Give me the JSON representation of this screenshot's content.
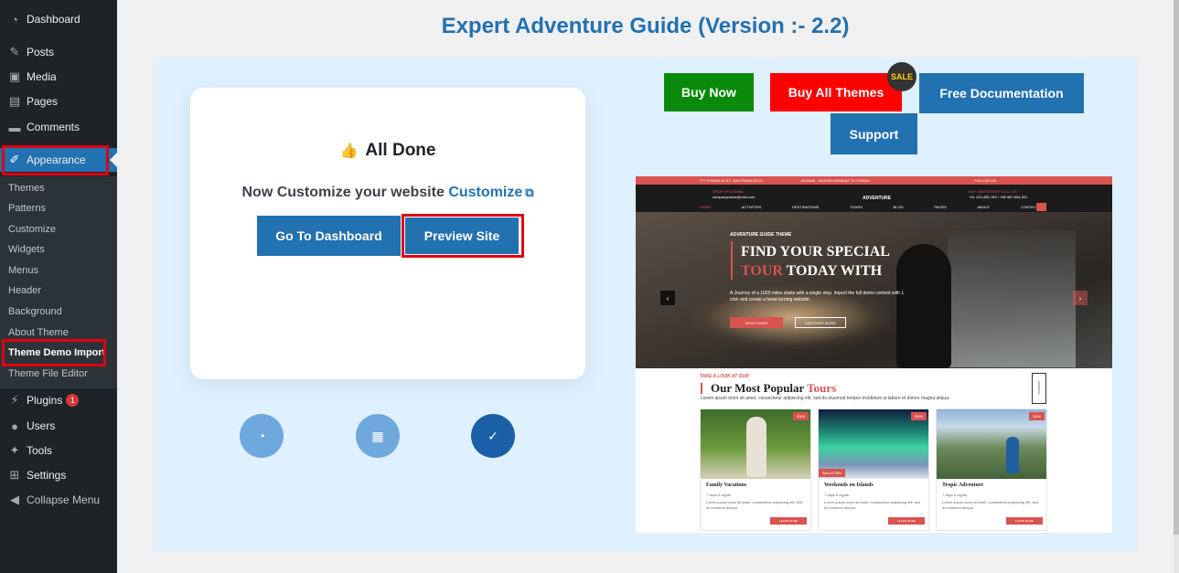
{
  "sidebar": {
    "items": [
      {
        "label": "Dashboard",
        "icon": "dashboard-icon"
      },
      {
        "label": "Posts",
        "icon": "pin-icon"
      },
      {
        "label": "Media",
        "icon": "media-icon"
      },
      {
        "label": "Pages",
        "icon": "pages-icon"
      },
      {
        "label": "Comments",
        "icon": "comments-icon"
      },
      {
        "label": "Appearance",
        "icon": "paintbrush-icon"
      }
    ],
    "submenu": [
      "Themes",
      "Patterns",
      "Customize",
      "Widgets",
      "Menus",
      "Header",
      "Background",
      "About Theme",
      "Theme Demo Import",
      "Theme File Editor"
    ],
    "lower": [
      {
        "label": "Plugins",
        "icon": "plugins-icon",
        "badge": "1"
      },
      {
        "label": "Users",
        "icon": "users-icon"
      },
      {
        "label": "Tools",
        "icon": "wrench-icon"
      },
      {
        "label": "Settings",
        "icon": "settings-icon"
      },
      {
        "label": "Collapse Menu",
        "icon": "collapse-icon"
      }
    ]
  },
  "page": {
    "title": "Expert Adventure Guide (Version :- 2.2)"
  },
  "card": {
    "title": "All Done",
    "subtitle_prefix": "Now Customize your website",
    "customize_link": "Customize",
    "dashboard_button": "Go To Dashboard",
    "preview_button": "Preview Site"
  },
  "actions": {
    "buy_now": "Buy Now",
    "buy_all": "Buy All Themes",
    "sale": "SALE",
    "docs": "Free Documentation",
    "support": "Support"
  },
  "preview": {
    "topbar_address": "777 FRANKLIN ST, SAN FRANCISCO",
    "topbar_hours": "10:00AM - 06:00PM MONDAY TO FRIDAY",
    "topbar_follow": "FOLLOW US:",
    "drop_label": "DROP US A EMAIL:",
    "drop_email": "companyname@mail.com",
    "logo": "ADVENTURE",
    "question_label": "ANY QUESTIONS? CALL US:",
    "question_phone": "+91 123-456-789 / +88 987-654-321",
    "nav": [
      "HOME",
      "ACTIVITIES",
      "DESTINATIONS",
      "TOURS",
      "BLOG",
      "PAGES",
      "ABOUT",
      "CONTACT"
    ],
    "hero_kicker": "ADVENTURE GUIDE THEME",
    "hero_line1": "FIND YOUR SPECIAL",
    "hero_line2_red": "TOUR",
    "hero_line2_rest": "TODAY WITH",
    "hero_text": "A Journey of a 1000 miles starts with a single step. Import the full demo content with 1 click and create a head-turning website.",
    "hero_btn1": "VIEW TOURS",
    "hero_btn2": "DISCOVER MORE",
    "section_kicker": "TAKE A LOOK AT OUR",
    "section_title": "Our Most Popular",
    "section_title_red": "Tours",
    "section_text": "Lorem ipsum dolor sit amet, consectetur adipiscing elit, sed do eiusmod tempor incididunt ut labore et dolore magna aliqua.",
    "side_btn": "SHOW ALL",
    "cards": [
      {
        "title": "Family Vacations",
        "price": "$300",
        "meta": "7 days 6 nights",
        "text": "Lorem ipsum dolor sit amet, consectetur adipiscing elit, sed do eiusmod tempor",
        "btn": "LEARN MORE",
        "tag": ""
      },
      {
        "title": "Weekends on Islands",
        "price": "$300",
        "meta": "7 days 6 nights",
        "text": "Lorem ipsum dolor sit amet, consectetur adipiscing elit, sed do eiusmod tempor",
        "btn": "LEARN MORE",
        "tag": "Special Offer"
      },
      {
        "title": "Tropic Adventure",
        "price": "$300",
        "meta": "7 days 6 nights",
        "text": "Lorem ipsum dolor sit amet, consectetur adipiscing elit, sed do eiusmod tempor",
        "btn": "LEARN MORE",
        "tag": ""
      }
    ]
  },
  "colors": {
    "accent": "#2271b1",
    "sidebar": "#1d2327",
    "panel": "#dff0ff",
    "green": "#0a8a0a",
    "red": "#ff0000"
  }
}
